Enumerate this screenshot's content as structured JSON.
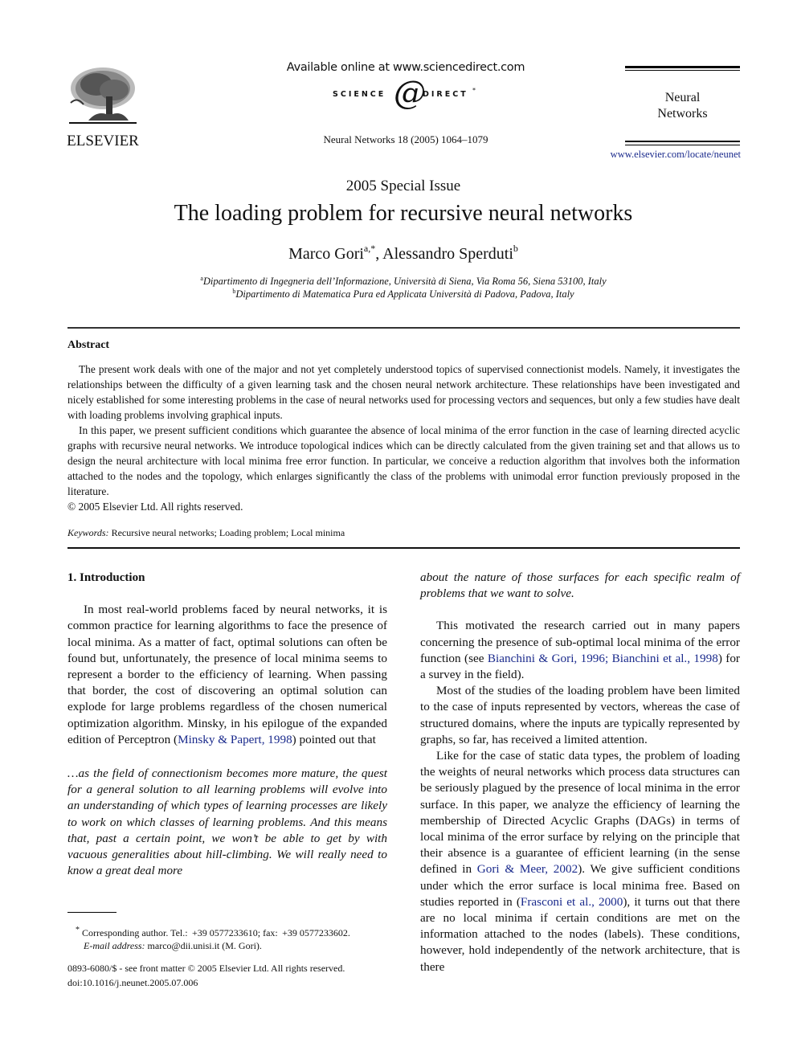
{
  "header": {
    "publisher_logo_text": "ELSEVIER",
    "available_online": "Available online at www.sciencedirect.com",
    "sciencedirect_left": "SCIENCE",
    "sciencedirect_at": "@",
    "sciencedirect_right": "DIRECT",
    "sciencedirect_mark": "*",
    "journal_ref": "Neural Networks 18 (2005) 1064–1079",
    "journal_name_line1": "Neural",
    "journal_name_line2": "Networks",
    "journal_url": "www.elsevier.com/locate/neunet"
  },
  "title_block": {
    "special_issue": "2005 Special Issue",
    "title": "The loading problem for recursive neural networks",
    "author1": "Marco Gori",
    "author1_sup": "a,*",
    "separator": ", ",
    "author2": "Alessandro Sperduti",
    "author2_sup": "b",
    "affiliation_a_sup": "a",
    "affiliation_a": "Dipartimento di Ingegneria dell’Informazione, Università di Siena, Via Roma 56, Siena 53100, Italy",
    "affiliation_b_sup": "b",
    "affiliation_b": "Dipartimento di Matematica Pura ed Applicata Università di Padova, Padova, Italy"
  },
  "abstract": {
    "heading": "Abstract",
    "para1": "The present work deals with one of the major and not yet completely understood topics of supervised connectionist models. Namely, it investigates the relationships between the difficulty of a given learning task and the chosen neural network architecture. These relationships have been investigated and nicely established for some interesting problems in the case of neural networks used for processing vectors and sequences, but only a few studies have dealt with loading problems involving graphical inputs.",
    "para2": "In this paper, we present sufficient conditions which guarantee the absence of local minima of the error function in the case of learning directed acyclic graphs with recursive neural networks. We introduce topological indices which can be directly calculated from the given training set and that allows us to design the neural architecture with local minima free error function. In particular, we conceive a reduction algorithm that involves both the information attached to the nodes and the topology, which enlarges significantly the class of the problems with unimodal error function previously proposed in the literature.",
    "copyright": "© 2005 Elsevier Ltd. All rights reserved."
  },
  "keywords": {
    "label": "Keywords:",
    "values": " Recursive neural networks; Loading problem; Local minima"
  },
  "intro": {
    "heading": "1. Introduction",
    "p1_text": "In most real-world problems faced by neural networks, it is common practice for learning algorithms to face the presence of local minima. As a matter of fact, optimal solutions can often be found but, unfortunately, the presence of local minima seems to represent a border to the efficiency of learning. When passing that border, the cost of discovering an optimal solution can explode for large problems regardless of the chosen numerical optimization algorithm. Minsky, in his epilogue of the expanded edition of Perceptron (",
    "p1_ref": "Minsky & Papert, 1998",
    "p1_end": ") pointed out that",
    "quote_left": "…as the field of connectionism becomes more mature, the quest for a general solution to all learning problems will evolve into an understanding of which types of learning processes are likely to work on which classes of learning problems. And this means that, past a certain point, we won’t be able to get by with vacuous generalities about hill-climbing. We will really need to know a great deal more",
    "quote_right": "about the nature of those surfaces for each specific realm of problems that we want to solve.",
    "p2_text": "This motivated the research carried out in many papers concerning the presence of sub-optimal local minima of the error function (see ",
    "p2_ref1": "Bianchini & Gori, 1996; Bianchini et al., 1998",
    "p2_end": ") for a survey in the field).",
    "p3_text": "Most of the studies of the loading problem have been limited to the case of inputs represented by vectors, whereas the case of structured domains, where the inputs are typically represented by graphs, so far, has received a limited attention.",
    "p4_text": "Like for the case of static data types, the problem of loading the weights of neural networks which process data structures can be seriously plagued by the presence of local minima in the error surface. In this paper, we analyze the efficiency of learning the membership of Directed Acyclic Graphs (DAGs) in terms of local minima of the error surface by relying on the principle that their absence is a guarantee of efficient learning (in the sense defined in ",
    "p4_ref1": "Gori & Meer, 2002",
    "p4_mid": "). We give sufficient conditions under which the error surface is local minima free. Based on studies reported in (",
    "p4_ref2": "Frasconi et al., 2000",
    "p4_end": "), it turns out that there are no local minima if certain conditions are met on the information attached to the nodes (labels). These conditions, however, hold independently of the network architecture, that is there"
  },
  "footnote": {
    "mark": "*",
    "corresponding": " Corresponding author. Tel.:  +39 0577233610; fax:  +39 0577233602.",
    "email_label": "E-mail address:",
    "email_value": " marco@dii.unisi.it (M. Gori)."
  },
  "frontmatter": {
    "issn_line": "0893-6080/$ - see front matter © 2005 Elsevier Ltd. All rights reserved.",
    "doi": "doi:10.1016/j.neunet.2005.07.006"
  },
  "colors": {
    "link": "#1a2a8c",
    "text": "#111111"
  }
}
